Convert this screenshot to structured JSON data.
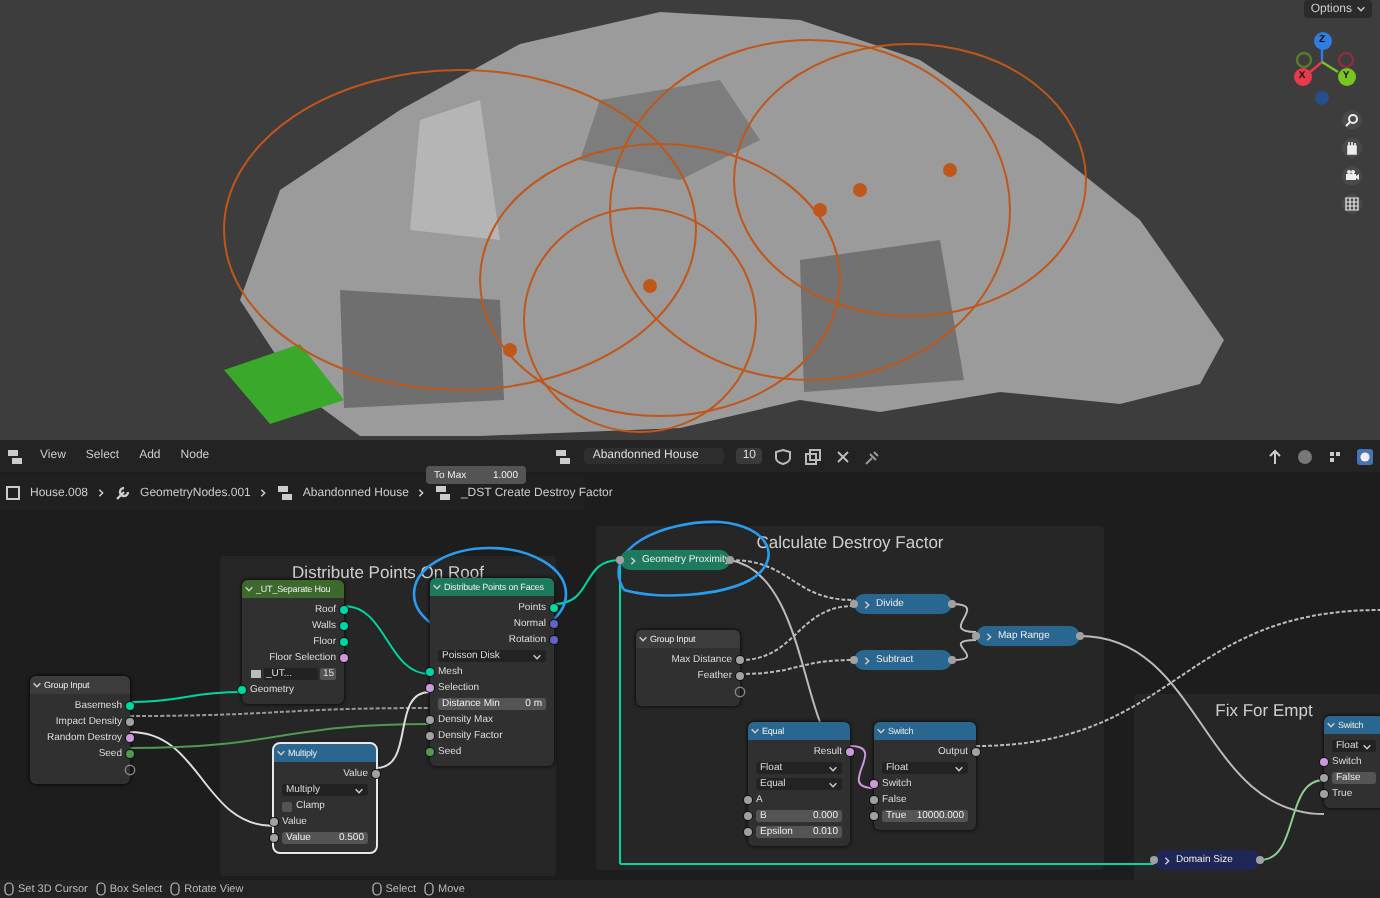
{
  "viewport": {
    "options_button": "Options",
    "gizmo_axes": [
      {
        "label": "Z",
        "color": "#2f7de1"
      },
      {
        "label": "X",
        "color": "#e83a4d"
      },
      {
        "label": "Y",
        "color": "#7ac51f"
      }
    ]
  },
  "header": {
    "menus": [
      "View",
      "Select",
      "Add",
      "Node"
    ],
    "node_group": "Abandonned House",
    "users": "10"
  },
  "breadcrumbs": [
    "House.008",
    "GeometryNodes.001",
    "Abandonned House",
    "_DST Create Destroy Factor"
  ],
  "tooltip": {
    "label": "To Max",
    "value": "1.000"
  },
  "frames": [
    {
      "title": "Distribute Points On Roof"
    },
    {
      "title": "Calculate Destroy Factor"
    },
    {
      "title": "Fix For Empt"
    }
  ],
  "nodes": [
    {
      "title": "_UT_Separate Hou",
      "color": "#3d6a2c",
      "collapsed": false,
      "selected": false,
      "rows": [
        {
          "kind": "output",
          "label": "Roof",
          "color": "#00d6a3"
        },
        {
          "kind": "output",
          "label": "Walls",
          "color": "#00d6a3"
        },
        {
          "kind": "output",
          "label": "Floor",
          "color": "#00d6a3"
        },
        {
          "kind": "output",
          "label": "Floor Selection",
          "color": "#cc99dd"
        },
        {
          "kind": "datablock",
          "label": "_UT...",
          "value": "15"
        },
        {
          "kind": "input",
          "label": "Geometry",
          "color": "#00d6a3"
        }
      ]
    },
    {
      "title": "Group Input",
      "color": "#3c3c3c",
      "collapsed": false,
      "selected": false,
      "rows": [
        {
          "kind": "output",
          "label": "Basemesh",
          "color": "#00d6a3"
        },
        {
          "kind": "output",
          "label": "Impact Density",
          "color": "#a1a1a1"
        },
        {
          "kind": "output",
          "label": "Random Destroy",
          "color": "#cc99dd"
        },
        {
          "kind": "output",
          "label": "Seed",
          "color": "#4f9a4f"
        },
        {
          "kind": "empty_socket"
        }
      ]
    },
    {
      "title": "Distribute Points on Faces",
      "color": "#1e7a5f",
      "collapsed": false,
      "selected": false,
      "rows": [
        {
          "kind": "output",
          "label": "Points",
          "color": "#00d6a3"
        },
        {
          "kind": "output",
          "label": "Normal",
          "color": "#6363c7"
        },
        {
          "kind": "output",
          "label": "Rotation",
          "color": "#6363c7"
        },
        {
          "kind": "dropdown",
          "label": "Poisson Disk"
        },
        {
          "kind": "input",
          "label": "Mesh",
          "color": "#00d6a3"
        },
        {
          "kind": "input",
          "label": "Selection",
          "color": "#cc99dd"
        },
        {
          "kind": "field",
          "label": "Distance Min",
          "value": "0 m"
        },
        {
          "kind": "input",
          "label": "Density Max",
          "color": "#a1a1a1"
        },
        {
          "kind": "input",
          "label": "Density Factor",
          "color": "#a1a1a1"
        },
        {
          "kind": "input",
          "label": "Seed",
          "color": "#4f9a4f"
        }
      ]
    },
    {
      "title": "Multiply",
      "color": "#2a6790",
      "collapsed": false,
      "selected": true,
      "rows": [
        {
          "kind": "output",
          "label": "Value",
          "color": "#a1a1a1"
        },
        {
          "kind": "dropdown",
          "label": "Multiply"
        },
        {
          "kind": "checkbox",
          "label": "Clamp",
          "checked": false
        },
        {
          "kind": "input",
          "label": "Value",
          "color": "#a1a1a1"
        },
        {
          "kind": "field",
          "label": "Value",
          "value": "0.500",
          "color": "#a1a1a1"
        }
      ]
    },
    {
      "title": "Geometry Proximity",
      "color": "#1e7a5f",
      "collapsed": true,
      "selected": false
    },
    {
      "title": "Group Input",
      "color": "#3c3c3c",
      "collapsed": false,
      "selected": false,
      "rows": [
        {
          "kind": "output",
          "label": "Max Distance",
          "color": "#a1a1a1"
        },
        {
          "kind": "output",
          "label": "Feather",
          "color": "#a1a1a1"
        },
        {
          "kind": "empty_socket"
        }
      ]
    },
    {
      "title": "Divide",
      "color": "#2a6790",
      "collapsed": true,
      "selected": false
    },
    {
      "title": "Subtract",
      "color": "#2a6790",
      "collapsed": true,
      "selected": false
    },
    {
      "title": "Map Range",
      "color": "#2a6790",
      "collapsed": true,
      "selected": false
    },
    {
      "title": "Equal",
      "color": "#2a6790",
      "collapsed": false,
      "selected": false,
      "rows": [
        {
          "kind": "output",
          "label": "Result",
          "color": "#cc99dd"
        },
        {
          "kind": "dropdown",
          "label": "Float"
        },
        {
          "kind": "dropdown",
          "label": "Equal"
        },
        {
          "kind": "input",
          "label": "A",
          "color": "#a1a1a1"
        },
        {
          "kind": "field",
          "label": "B",
          "value": "0.000",
          "color": "#a1a1a1"
        },
        {
          "kind": "field",
          "label": "Epsilon",
          "value": "0.010",
          "color": "#a1a1a1"
        }
      ]
    },
    {
      "title": "Switch",
      "color": "#2a6790",
      "collapsed": false,
      "selected": false,
      "rows": [
        {
          "kind": "output",
          "label": "Output",
          "color": "#a1a1a1"
        },
        {
          "kind": "dropdown",
          "label": "Float"
        },
        {
          "kind": "input",
          "label": "Switch",
          "color": "#cc99dd"
        },
        {
          "kind": "input",
          "label": "False",
          "color": "#a1a1a1"
        },
        {
          "kind": "field",
          "label": "True",
          "value": "10000.000",
          "color": "#a1a1a1"
        }
      ]
    },
    {
      "title": "Domain Size",
      "color": "#1e2756",
      "collapsed": true,
      "selected": false
    },
    {
      "title": "Switch",
      "color": "#2a6790",
      "collapsed": false,
      "selected": false,
      "rows": [
        {
          "kind": "dropdown",
          "label": "Float"
        },
        {
          "kind": "input",
          "label": "Switch",
          "color": "#cc99dd"
        },
        {
          "kind": "field",
          "label": "False",
          "color": "#a1a1a1"
        },
        {
          "kind": "input",
          "label": "True",
          "color": "#a1a1a1"
        }
      ]
    }
  ],
  "status_bar": [
    {
      "action": "Set 3D Cursor"
    },
    {
      "action": "Box Select"
    },
    {
      "action": "Rotate View"
    },
    {
      "action": "Select"
    },
    {
      "action": "Move"
    }
  ]
}
